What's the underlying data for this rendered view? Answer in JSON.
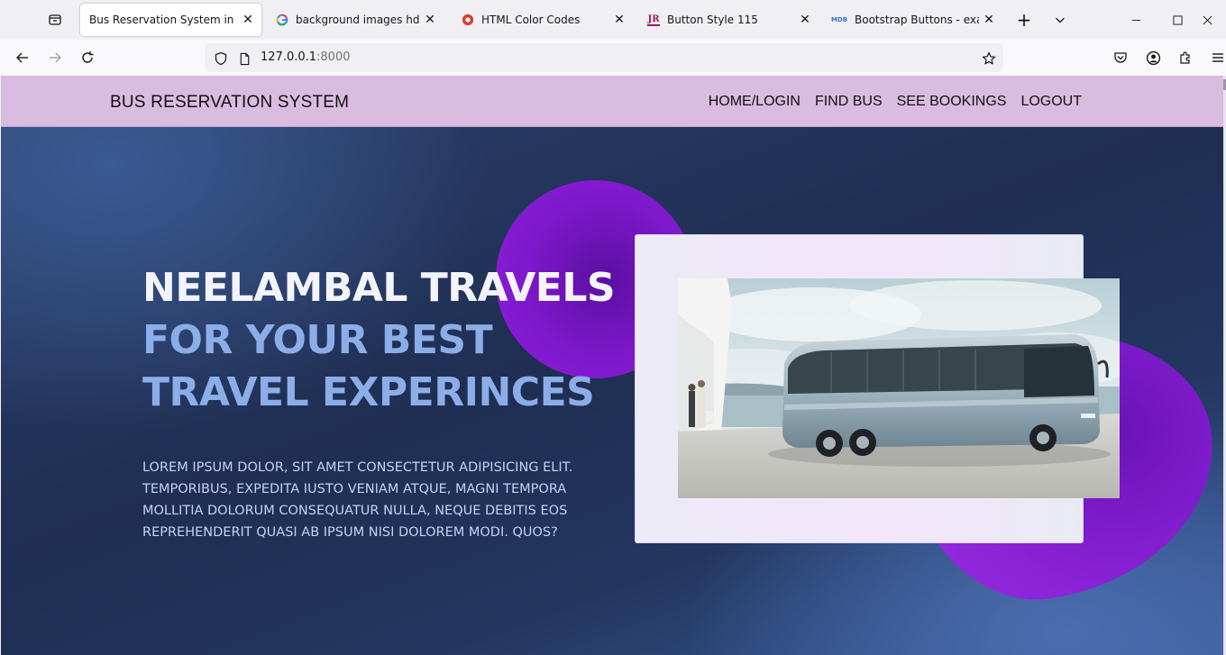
{
  "browser": {
    "tabs": [
      {
        "title": "Bus Reservation System in Django",
        "active": true,
        "icon": "none"
      },
      {
        "title": "background images hd - Google Search",
        "active": false,
        "icon": "google-icon"
      },
      {
        "title": "HTML Color Codes",
        "active": false,
        "icon": "htmlcolor-icon"
      },
      {
        "title": "Button Style 115",
        "active": false,
        "icon": "jr-icon"
      },
      {
        "title": "Bootstrap Buttons - examples",
        "active": false,
        "icon": "mdb-icon"
      }
    ],
    "url_host": "127.0.0.1",
    "url_port": ":8000",
    "favicon_text": {
      "jr": "JR",
      "mdb": "MDB"
    }
  },
  "site": {
    "brand": "BUS RESERVATION SYSTEM",
    "menu": [
      "HOME/LOGIN",
      "FIND BUS",
      "SEE BOOKINGS",
      "LOGOUT"
    ]
  },
  "hero": {
    "line1": "NEELAMBAL TRAVELS",
    "line2": "FOR YOUR BEST",
    "line3": "TRAVEL EXPERINCES",
    "description": "LOREM IPSUM DOLOR, SIT AMET CONSECTETUR ADIPISICING ELIT. TEMPORIBUS, EXPEDITA IUSTO VENIAM ATQUE, MAGNI TEMPORA MOLLITIA DOLORUM CONSEQUATUR NULLA, NEQUE DEBITIS EOS REPREHENDERIT QUASI AB IPSUM NISI DOLOREM MODI. QUOS?"
  },
  "colors": {
    "header_bg": "#dabce0",
    "headline_primary": "#f3f4f9",
    "headline_accent": "#8caee8",
    "blob": "#8a22d6"
  }
}
